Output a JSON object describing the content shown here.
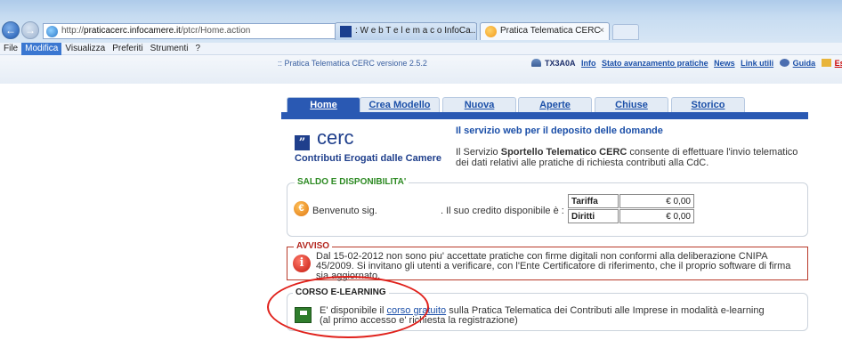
{
  "browser": {
    "url_prefix": "http://",
    "url_host": "praticacerc.infocamere.it",
    "url_path": "/ptcr/Home.action",
    "address_controls": "⌕ ▾ ¢ ✕",
    "tabs": [
      {
        "title": ": W e b T e l e m a c o InfoCa..."
      },
      {
        "title": "Pratica Telematica CERC",
        "close": "×"
      }
    ],
    "menu": [
      "File",
      "Modifica",
      "Visualizza",
      "Preferiti",
      "Strumenti",
      "?"
    ]
  },
  "header": {
    "version": ":: Pratica Telematica CERC versione 2.5.2",
    "user": "TX3A0A",
    "links": [
      "Info",
      "Stato avanzamento pratiche",
      "News",
      "Link utili",
      "Guida",
      "Esci"
    ]
  },
  "nav_tabs": [
    "Home",
    "Crea Modello",
    "Nuova",
    "Aperte",
    "Chiuse",
    "Storico"
  ],
  "logo": {
    "mark": "”",
    "name": "cerc",
    "subtitle": "Contributi Erogati dalle Camere"
  },
  "intro": {
    "title": "Il servizio web per il deposito delle domande",
    "text_before": "Il Servizio ",
    "text_bold": "Sportello Telematico CERC",
    "text_after": " consente di effettuare l'invio telematico dei dati relativi alle pratiche di richiesta contributi alla CdC."
  },
  "saldo": {
    "title": "SALDO E DISPONIBILITA'",
    "icon": "€",
    "welcome": "Benvenuto sig.",
    "credit_label": ". Il suo credito disponibile è :",
    "rows": [
      {
        "label": "Tariffa",
        "value": "€ 0,00"
      },
      {
        "label": "Diritti",
        "value": "€ 0,00"
      }
    ]
  },
  "avviso": {
    "title": "AVVISO",
    "icon": "i",
    "text": "Dal 15-02-2012 non sono piu' accettate pratiche con firme digitali non conformi alla deliberazione CNIPA 45/2009. Si invitano gli utenti a verificare, con l'Ente Certificatore di riferimento, che il proprio software di firma sia aggiornato."
  },
  "corso": {
    "title": "CORSO E-LEARNING",
    "text_before": "E' disponibile il ",
    "link": "corso gratuito",
    "text_after": " sulla Pratica Telematica dei Contributi alle Imprese in modalità e-learning",
    "line2": "(al primo accesso e' richiesta la registrazione)"
  }
}
